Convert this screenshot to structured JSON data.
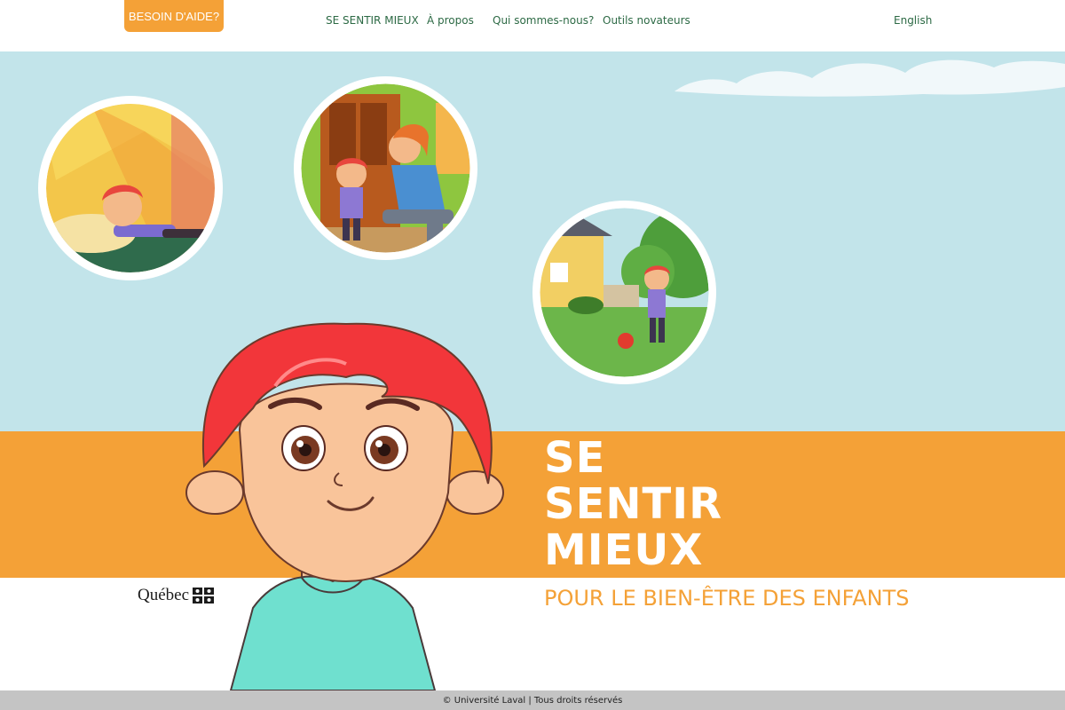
{
  "header": {
    "help_button": "BESOIN D'AIDE?",
    "nav": [
      "SE SENTIR MIEUX",
      "À propos",
      "Qui sommes-nous?",
      "Outils novateurs"
    ],
    "language": "English"
  },
  "hero": {
    "title_lines": [
      "SE",
      "SENTIR",
      "MIEUX"
    ],
    "subtitle": "POUR LE BIEN-ÊTRE DES ENFANTS",
    "logo_text": "Québec"
  },
  "footer": {
    "text": "© Université Laval | Tous droits réservés"
  },
  "colors": {
    "accent": "#f4a137",
    "sky": "#c2e4ea",
    "nav_text": "#2d6a45",
    "footer_bg": "#c4c4c4"
  }
}
